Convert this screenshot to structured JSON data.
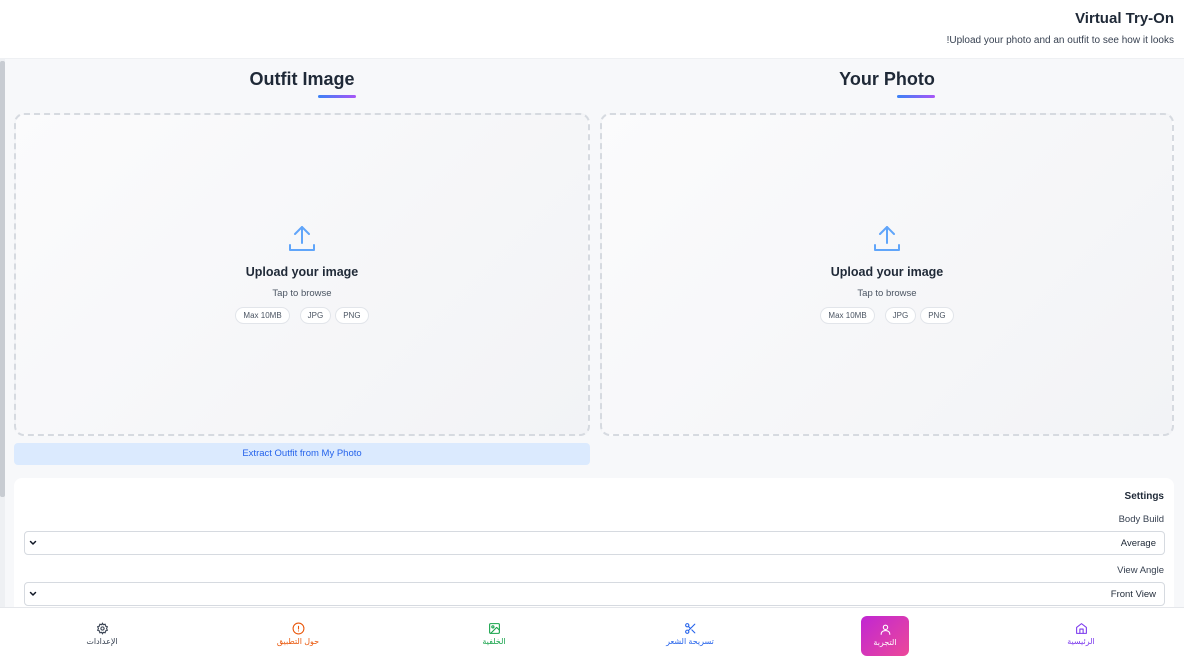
{
  "header": {
    "title": "Virtual Try-On",
    "subtitle": "!Upload your photo and an outfit to see how it looks"
  },
  "panels": {
    "outfit": {
      "title": "Outfit Image",
      "upload_heading": "Upload your image",
      "upload_sub": "Tap to browse",
      "chips": [
        "Max 10MB",
        "JPG",
        "PNG"
      ],
      "icon": "upload-icon"
    },
    "photo": {
      "title": "Your Photo",
      "upload_heading": "Upload your image",
      "upload_sub": "Tap to browse",
      "chips": [
        "Max 10MB",
        "JPG",
        "PNG"
      ],
      "icon": "upload-icon"
    }
  },
  "extract_button": "Extract Outfit from My Photo",
  "settings": {
    "title": "Settings",
    "body_build": {
      "label": "Body Build",
      "value": "Average"
    },
    "view_angle": {
      "label": "View Angle",
      "value": "Front View"
    }
  },
  "nav": {
    "items": [
      {
        "label": "الإعدادات",
        "icon": "gear-icon",
        "color": "#374151"
      },
      {
        "label": "حول التطبيق",
        "icon": "info-icon",
        "color": "#ea580c"
      },
      {
        "label": "الخلفية",
        "icon": "image-icon",
        "color": "#16a34a"
      },
      {
        "label": "تسريحة الشعر",
        "icon": "scissors-icon",
        "color": "#2563eb"
      },
      {
        "label": "التجربة",
        "icon": "user-icon",
        "color": "#ffffff",
        "active": true
      },
      {
        "label": "الرئيسية",
        "icon": "home-icon",
        "color": "#7c3aed"
      }
    ]
  },
  "colors": {
    "accent_gradient_start": "#3b82f6",
    "accent_gradient_end": "#a855f7",
    "active_nav_start": "#c026d3",
    "active_nav_end": "#ec4899",
    "upload_icon": "#60a5fa"
  }
}
